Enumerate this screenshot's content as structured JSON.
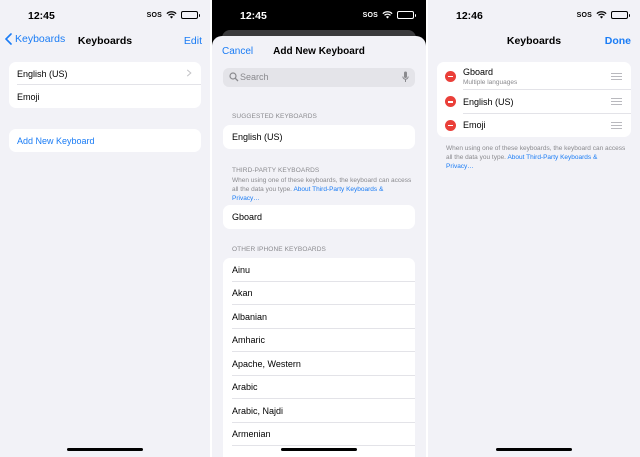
{
  "colors": {
    "accent": "#1a7cf5",
    "remove": "#ea3f39",
    "background": "#f2f2f7"
  },
  "screen1": {
    "status": {
      "time": "12:45",
      "sos": "SOS"
    },
    "nav": {
      "back_label": "Keyboards",
      "title": "Keyboards",
      "edit_label": "Edit"
    },
    "keyboards": [
      "English (US)",
      "Emoji"
    ],
    "add_keyboard_label": "Add New Keyboard"
  },
  "screen2": {
    "status": {
      "time": "12:45",
      "sos": "SOS"
    },
    "sheet": {
      "cancel_label": "Cancel",
      "title": "Add New Keyboard",
      "search_placeholder": "Search",
      "suggested_header": "SUGGESTED KEYBOARDS",
      "suggested": [
        "English (US)"
      ],
      "third_party_header": "THIRD-PARTY KEYBOARDS",
      "third_party_note": "When using one of these keyboards, the keyboard can access all the data you type.",
      "third_party_link": "About Third-Party Keyboards & Privacy…",
      "third_party": [
        "Gboard"
      ],
      "other_header": "OTHER IPHONE KEYBOARDS",
      "other": [
        "Ainu",
        "Akan",
        "Albanian",
        "Amharic",
        "Apache, Western",
        "Arabic",
        "Arabic, Najdi",
        "Armenian"
      ]
    }
  },
  "screen3": {
    "status": {
      "time": "12:46",
      "sos": "SOS"
    },
    "nav": {
      "title": "Keyboards",
      "done_label": "Done"
    },
    "keyboards": [
      {
        "name": "Gboard",
        "subtitle": "Multiple languages"
      },
      {
        "name": "English (US)"
      },
      {
        "name": "Emoji"
      }
    ],
    "note": "When using one of these keyboards, the keyboard can access all the data you type.",
    "link": "About Third-Party Keyboards & Privacy…"
  }
}
